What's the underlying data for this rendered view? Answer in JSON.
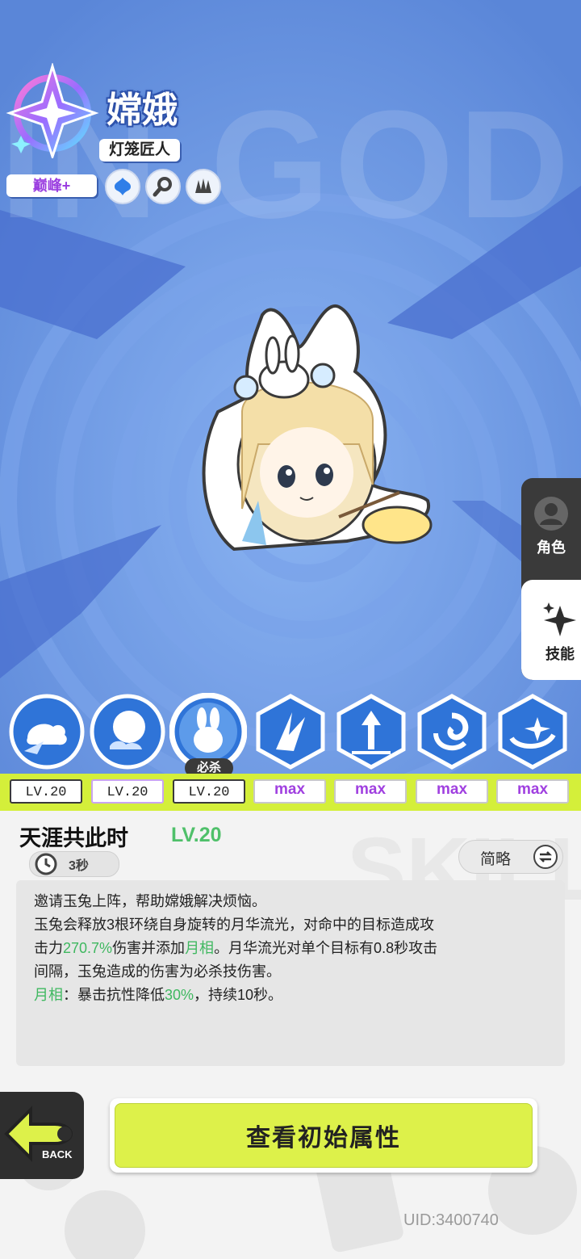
{
  "background_text": "IN GOD",
  "character": {
    "name": "嫦娥",
    "title": "灯笼匠人",
    "rank": "巅峰+",
    "tags": [
      "water-splash-icon",
      "magnifier-icon",
      "claw-icon"
    ]
  },
  "side_tabs": [
    {
      "label": "角色",
      "icon": "avatar-icon"
    },
    {
      "label": "技能",
      "icon": "sparkle-star-icon"
    }
  ],
  "skills": [
    {
      "icon": "cloud-rabbit-icon",
      "level": "LV.20"
    },
    {
      "icon": "moon-cloud-icon",
      "level": "LV.20"
    },
    {
      "icon": "jade-rabbit-icon",
      "level": "LV.20",
      "badge": "必杀",
      "selected": true
    },
    {
      "icon": "slash-icon",
      "level": "max"
    },
    {
      "icon": "arrows-up-icon",
      "level": "max"
    },
    {
      "icon": "vortex-icon",
      "level": "max"
    },
    {
      "icon": "swirl-star-icon",
      "level": "max"
    }
  ],
  "detail": {
    "skill_name": "天涯共此时",
    "skill_level": "LV.20",
    "cooldown": "3秒",
    "toggle_label": "简略",
    "desc": {
      "line1": "邀请玉兔上阵，帮助嫦娥解决烦恼。",
      "line2": "玉兔会释放3根环绕自身旋转的月华流光，对命中的目标造成攻",
      "line3_a": "击力",
      "line3_b": "270.7%",
      "line3_c": "伤害并添加",
      "line3_d": "月相",
      "line3_e": "。月华流光对单个目标有0.8秒攻击",
      "line4": "间隔，玉兔造成的伤害为必杀技伤害。",
      "line5_a": "月相",
      "line5_b": "：暴击抗性降低",
      "line5_c": "30%",
      "line5_d": "，持续10秒。"
    }
  },
  "buttons": {
    "back": "BACK",
    "view_initial": "查看初始属性"
  },
  "uid": "UID:3400740",
  "colors": {
    "scene_blue": "#5e8fe0",
    "accent_green": "#3fb860",
    "lime": "#d4ef3a",
    "max_purple": "#a040e0"
  }
}
